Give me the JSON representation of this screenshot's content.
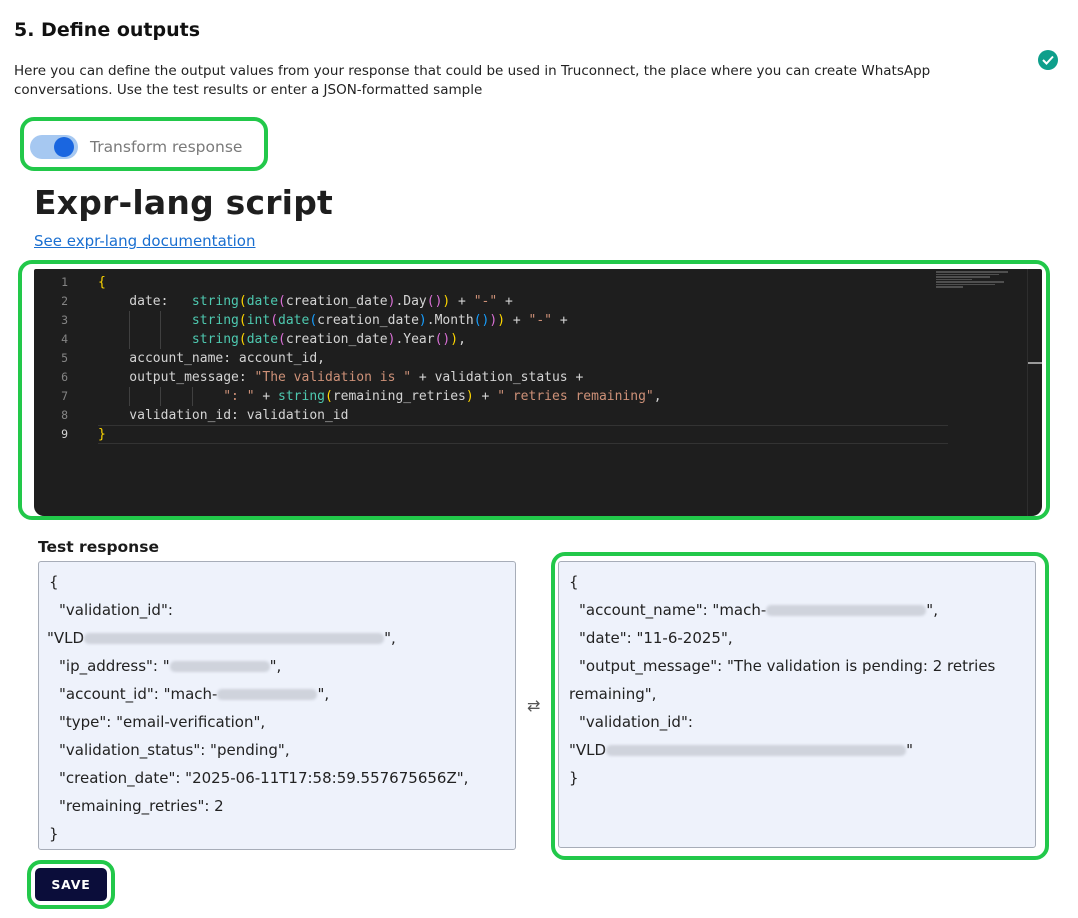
{
  "section": {
    "title": "5. Define outputs",
    "description": "Here you can define the output values from your response that could be used in Truconnect, the place where you can create WhatsApp conversations. Use the test results or enter a JSON-formatted sample"
  },
  "status_icon": "check-circle-icon",
  "transform_toggle": {
    "label": "Transform response",
    "checked": true
  },
  "script": {
    "title": "Expr-lang script",
    "doc_link": "See expr-lang documentation",
    "line_numbers": [
      "1",
      "2",
      "3",
      "4",
      "5",
      "6",
      "7",
      "8",
      "9"
    ],
    "lines": [
      "{",
      "    date:   string(date(creation_date).Day()) + \"-\" +",
      "            string(int(date(creation_date).Month())) + \"-\" +",
      "            string(date(creation_date).Year()),",
      "    account_name: account_id,",
      "    output_message: \"The validation is \" + validation_status +",
      "                \": \" + string(remaining_retries) + \" retries remaining\",",
      "    validation_id: validation_id",
      "}"
    ],
    "active_line": 9
  },
  "test_response": {
    "label": "Test response",
    "input_lines": {
      "open": "{",
      "validation_id_key": "\"validation_id\":",
      "validation_id_prefix": "\"VLD",
      "ip_address_key": "\"ip_address\": \"",
      "account_id_key": "\"account_id\": \"mach-",
      "type_line": "\"type\": \"email-verification\",",
      "validation_status_line": "\"validation_status\": \"pending\",",
      "creation_date_line": "\"creation_date\": \"2025-06-11T17:58:59.557675656Z\",",
      "remaining_retries_line": "\"remaining_retries\": 2",
      "close": "}"
    },
    "output_lines": {
      "open": "{",
      "account_name_key": "\"account_name\": \"mach-",
      "date_line": "\"date\": \"11-6-2025\",",
      "output_message_line1": "\"output_message\": \"The validation is pending: 2 retries",
      "output_message_line2": "remaining\",",
      "validation_id_key": "\"validation_id\":",
      "validation_id_prefix": "\"VLD",
      "close": "}"
    },
    "swap_icon": "swap-arrows-icon"
  },
  "save_button": {
    "label": "SAVE"
  },
  "colors": {
    "highlight": "#22c84a",
    "save_bg": "#0b0d3a",
    "editor_bg": "#1e1e1e",
    "panel_bg": "#eef2fb"
  }
}
